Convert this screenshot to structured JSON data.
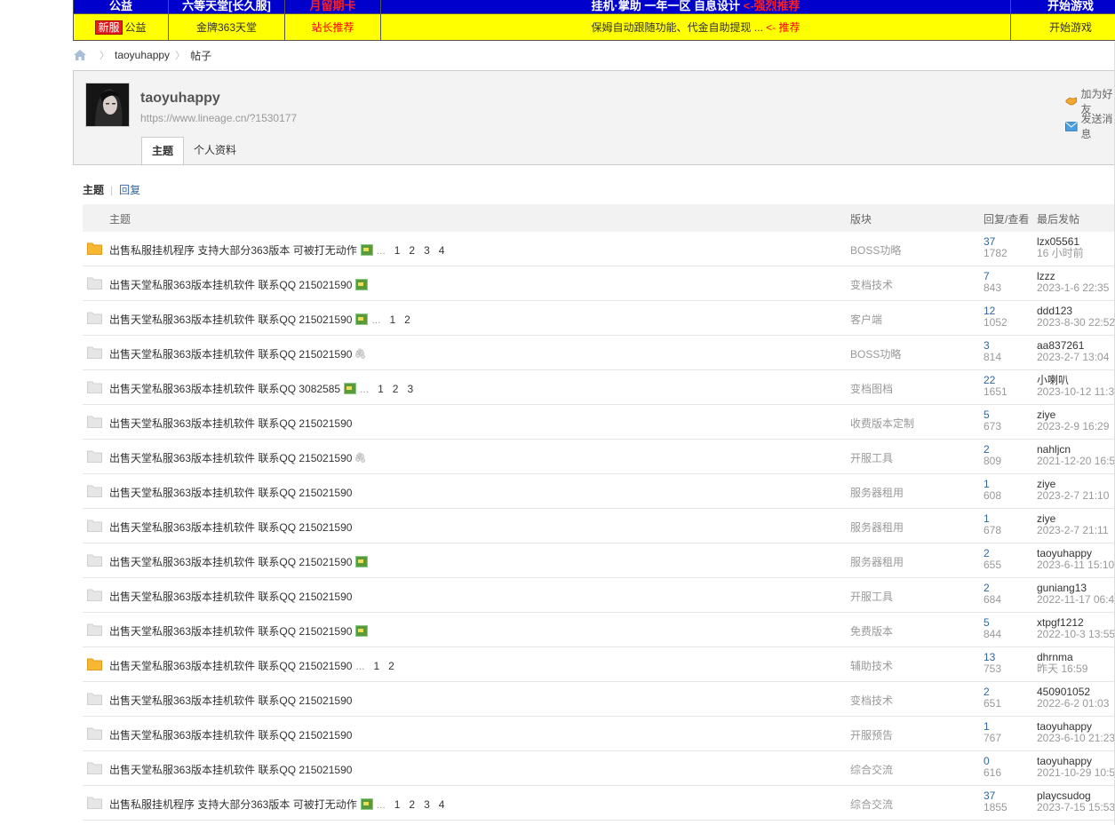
{
  "banner": {
    "row1": [
      {
        "text": "公益",
        "red": ""
      },
      {
        "text": "六等天堂[长久服]",
        "red": ""
      },
      {
        "text": "",
        "red": "月留期卡"
      },
      {
        "text": "挂机·掌助 一年一区 自息设计",
        "red": "<-强烈推荐"
      },
      {
        "text": "开始游戏",
        "red": ""
      }
    ],
    "row2": [
      {
        "badge": "新服",
        "text": "公益"
      },
      {
        "text": "金牌363天堂"
      },
      {
        "red": "站长推荐"
      },
      {
        "text": "保姆自动跟随功能、代金自助提现 ... ",
        "red": "<- 推荐"
      },
      {
        "text": "开始游戏"
      }
    ]
  },
  "breadcrumb": {
    "items": [
      "taoyuhappy",
      "帖子"
    ]
  },
  "profile": {
    "username": "taoyuhappy",
    "url": "https://www.lineage.cn/?1530177",
    "add_friend": "加为好友",
    "send_message": "发送消息",
    "tabs": [
      "主题",
      "个人资料"
    ]
  },
  "subtabs": {
    "active": "主题",
    "other": "回复"
  },
  "table": {
    "headers": {
      "subject": "主题",
      "forum": "版块",
      "replies": "回复/查看",
      "last": "最后发帖"
    },
    "rows": [
      {
        "icon": "folder-hot",
        "title": "出售私服挂机程序 支持大部分363版本 可被打无动作",
        "img": true,
        "clip": false,
        "pages": [
          "1",
          "2",
          "3",
          "4"
        ],
        "forum": "BOSS功略",
        "replies": "37",
        "views": "1782",
        "user": "lzx05561",
        "time": "16 小时前"
      },
      {
        "icon": "doc",
        "title": "出售天堂私服363版本挂机软件 联系QQ 215021590",
        "img": true,
        "clip": false,
        "pages": [],
        "forum": "变档技术",
        "replies": "7",
        "views": "843",
        "user": "lzzz",
        "time": "2023-1-6 22:35"
      },
      {
        "icon": "doc",
        "title": "出售天堂私服363版本挂机软件 联系QQ 215021590",
        "img": true,
        "clip": false,
        "pages": [
          "1",
          "2"
        ],
        "forum": "客户端",
        "replies": "12",
        "views": "1052",
        "user": "ddd123",
        "time": "2023-8-30 22:52"
      },
      {
        "icon": "doc",
        "title": "出售天堂私服363版本挂机软件 联系QQ 215021590",
        "img": false,
        "clip": true,
        "pages": [],
        "forum": "BOSS功略",
        "replies": "3",
        "views": "814",
        "user": "aa837261",
        "time": "2023-2-7 13:04"
      },
      {
        "icon": "doc",
        "title": "出售天堂私服363版本挂机软件 联系QQ 3082585",
        "img": true,
        "clip": false,
        "pages": [
          "1",
          "2",
          "3"
        ],
        "forum": "变档图档",
        "replies": "22",
        "views": "1651",
        "user": "小喇叭",
        "time": "2023-10-12 11:3"
      },
      {
        "icon": "doc",
        "title": "出售天堂私服363版本挂机软件 联系QQ 215021590",
        "img": false,
        "clip": false,
        "pages": [],
        "forum": "收费版本定制",
        "replies": "5",
        "views": "673",
        "user": "ziye",
        "time": "2023-2-9 16:29"
      },
      {
        "icon": "doc",
        "title": "出售天堂私服363版本挂机软件 联系QQ 215021590",
        "img": false,
        "clip": true,
        "pages": [],
        "forum": "开服工具",
        "replies": "2",
        "views": "809",
        "user": "nahljcn",
        "time": "2021-12-20 16:5"
      },
      {
        "icon": "doc",
        "title": "出售天堂私服363版本挂机软件 联系QQ 215021590",
        "img": false,
        "clip": false,
        "pages": [],
        "forum": "服务器租用",
        "replies": "1",
        "views": "608",
        "user": "ziye",
        "time": "2023-2-7 21:10"
      },
      {
        "icon": "doc",
        "title": "出售天堂私服363版本挂机软件 联系QQ 215021590",
        "img": false,
        "clip": false,
        "pages": [],
        "forum": "服务器租用",
        "replies": "1",
        "views": "678",
        "user": "ziye",
        "time": "2023-2-7 21:11"
      },
      {
        "icon": "doc",
        "title": "出售天堂私服363版本挂机软件 联系QQ 215021590",
        "img": true,
        "clip": false,
        "pages": [],
        "forum": "服务器租用",
        "replies": "2",
        "views": "655",
        "user": "taoyuhappy",
        "time": "2023-6-11 15:10"
      },
      {
        "icon": "doc",
        "title": "出售天堂私服363版本挂机软件 联系QQ 215021590",
        "img": false,
        "clip": false,
        "pages": [],
        "forum": "开服工具",
        "replies": "2",
        "views": "684",
        "user": "guniang13",
        "time": "2022-11-17 06:4"
      },
      {
        "icon": "doc",
        "title": "出售天堂私服363版本挂机软件 联系QQ 215021590",
        "img": true,
        "clip": false,
        "pages": [],
        "forum": "免费版本",
        "replies": "5",
        "views": "844",
        "user": "xtpgf1212",
        "time": "2022-10-3 13:55"
      },
      {
        "icon": "folder-hot",
        "title": "出售天堂私服363版本挂机软件 联系QQ 215021590",
        "img": false,
        "clip": false,
        "pages": [
          "1",
          "2"
        ],
        "forum": "辅助技术",
        "replies": "13",
        "views": "753",
        "user": "dhrnma",
        "time": "昨天 16:59"
      },
      {
        "icon": "doc",
        "title": "出售天堂私服363版本挂机软件 联系QQ 215021590",
        "img": false,
        "clip": false,
        "pages": [],
        "forum": "变档技术",
        "replies": "2",
        "views": "651",
        "user": "450901052",
        "time": "2022-6-2 01:03"
      },
      {
        "icon": "doc",
        "title": "出售天堂私服363版本挂机软件 联系QQ 215021590",
        "img": false,
        "clip": false,
        "pages": [],
        "forum": "开服预告",
        "replies": "1",
        "views": "767",
        "user": "taoyuhappy",
        "time": "2023-6-10 21:23"
      },
      {
        "icon": "doc",
        "title": "出售天堂私服363版本挂机软件 联系QQ 215021590",
        "img": false,
        "clip": false,
        "pages": [],
        "forum": "综合交流",
        "replies": "0",
        "views": "616",
        "user": "taoyuhappy",
        "time": "2021-10-29 10:5"
      },
      {
        "icon": "doc",
        "title": "出售私服挂机程序 支持大部分363版本 可被打无动作",
        "img": true,
        "clip": false,
        "pages": [
          "1",
          "2",
          "3",
          "4"
        ],
        "forum": "综合交流",
        "replies": "37",
        "views": "1855",
        "user": "playcsudog",
        "time": "2023-7-15 15:53"
      }
    ]
  },
  "colors": {
    "banner_blue": "#0000cc",
    "banner_yellow": "#ffff00",
    "link": "#336699",
    "hot_folder": "#f7b733"
  }
}
